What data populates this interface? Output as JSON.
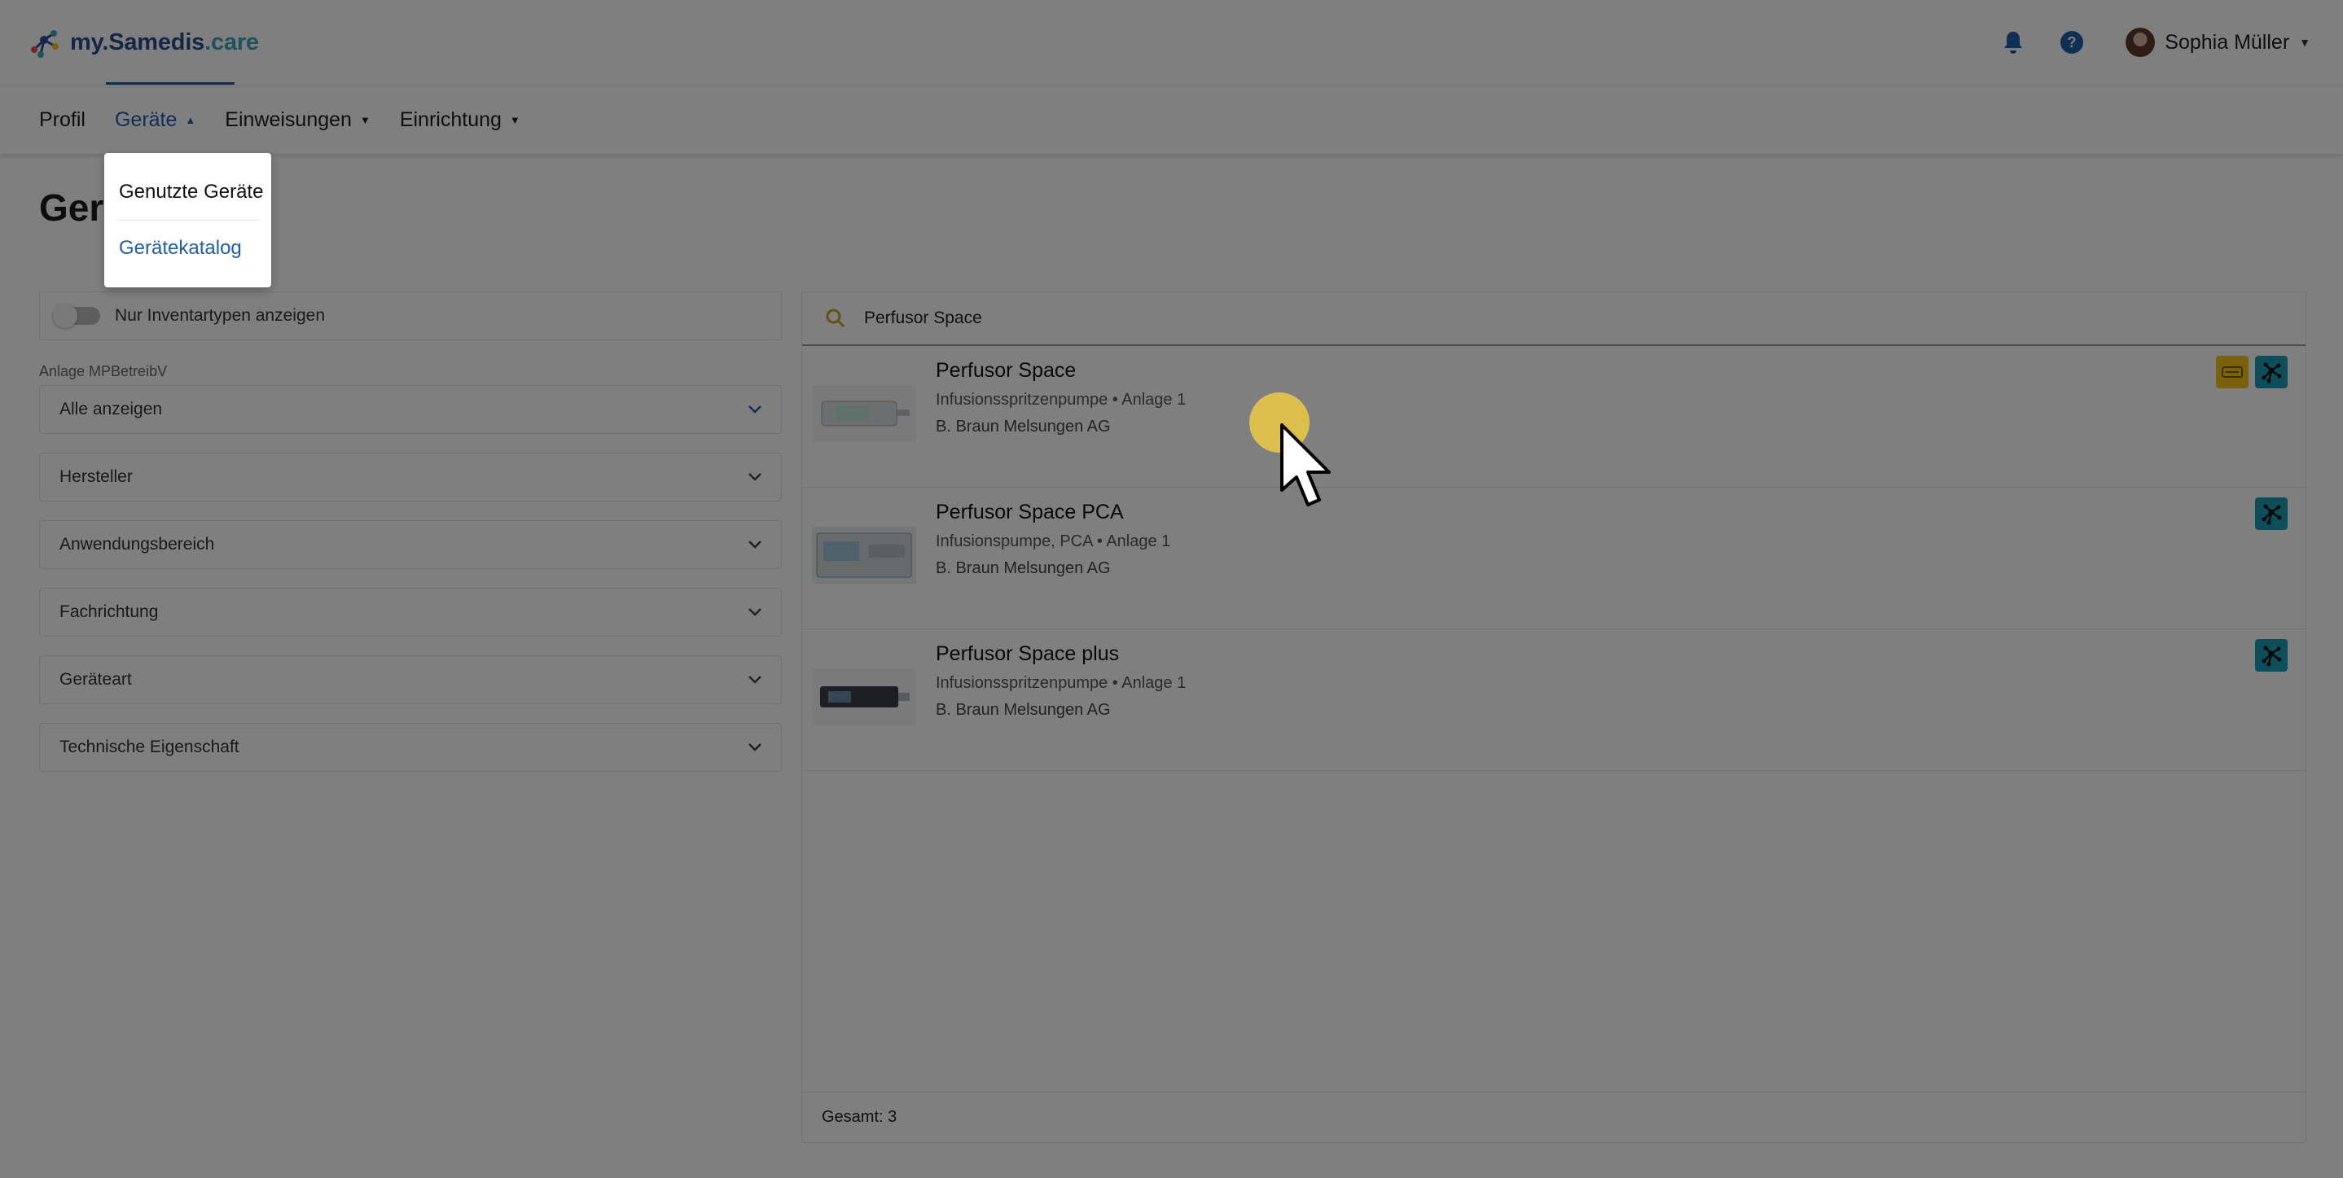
{
  "header": {
    "logo_prefix": "my.Samedis",
    "logo_suffix": ".care",
    "user_name": "Sophia Müller"
  },
  "nav": {
    "items": [
      {
        "label": "Profil"
      },
      {
        "label": "Geräte"
      },
      {
        "label": "Einweisungen"
      },
      {
        "label": "Einrichtung"
      }
    ],
    "dropdown": [
      {
        "label": "Genutzte Geräte"
      },
      {
        "label": "Gerätekatalog"
      }
    ]
  },
  "page": {
    "title": "Geräte"
  },
  "filters": {
    "toggle_label": "Nur Inventartypen anzeigen",
    "anlage_caption": "Anlage MPBetreibV",
    "anlage_value": "Alle anzeigen",
    "selects": [
      {
        "label": "Hersteller"
      },
      {
        "label": "Anwendungsbereich"
      },
      {
        "label": "Fachrichtung"
      },
      {
        "label": "Geräteart"
      },
      {
        "label": "Technische Eigenschaft"
      }
    ]
  },
  "search": {
    "value": "Perfusor Space"
  },
  "results": [
    {
      "title": "Perfusor Space",
      "subtitle": "Infusionsspritzenpumpe • Anlage 1",
      "maker": "B. Braun Melsungen AG"
    },
    {
      "title": "Perfusor Space PCA",
      "subtitle": "Infusionspumpe, PCA • Anlage 1",
      "maker": "B. Braun Melsungen AG"
    },
    {
      "title": "Perfusor Space plus",
      "subtitle": "Infusionsspritzenpumpe • Anlage 1",
      "maker": "B. Braun Melsungen AG"
    }
  ],
  "footer": {
    "total": "Gesamt: 3"
  },
  "colors": {
    "primary": "#1f5fa8",
    "teal": "#1c9db7",
    "yellow": "#f2c21a"
  }
}
